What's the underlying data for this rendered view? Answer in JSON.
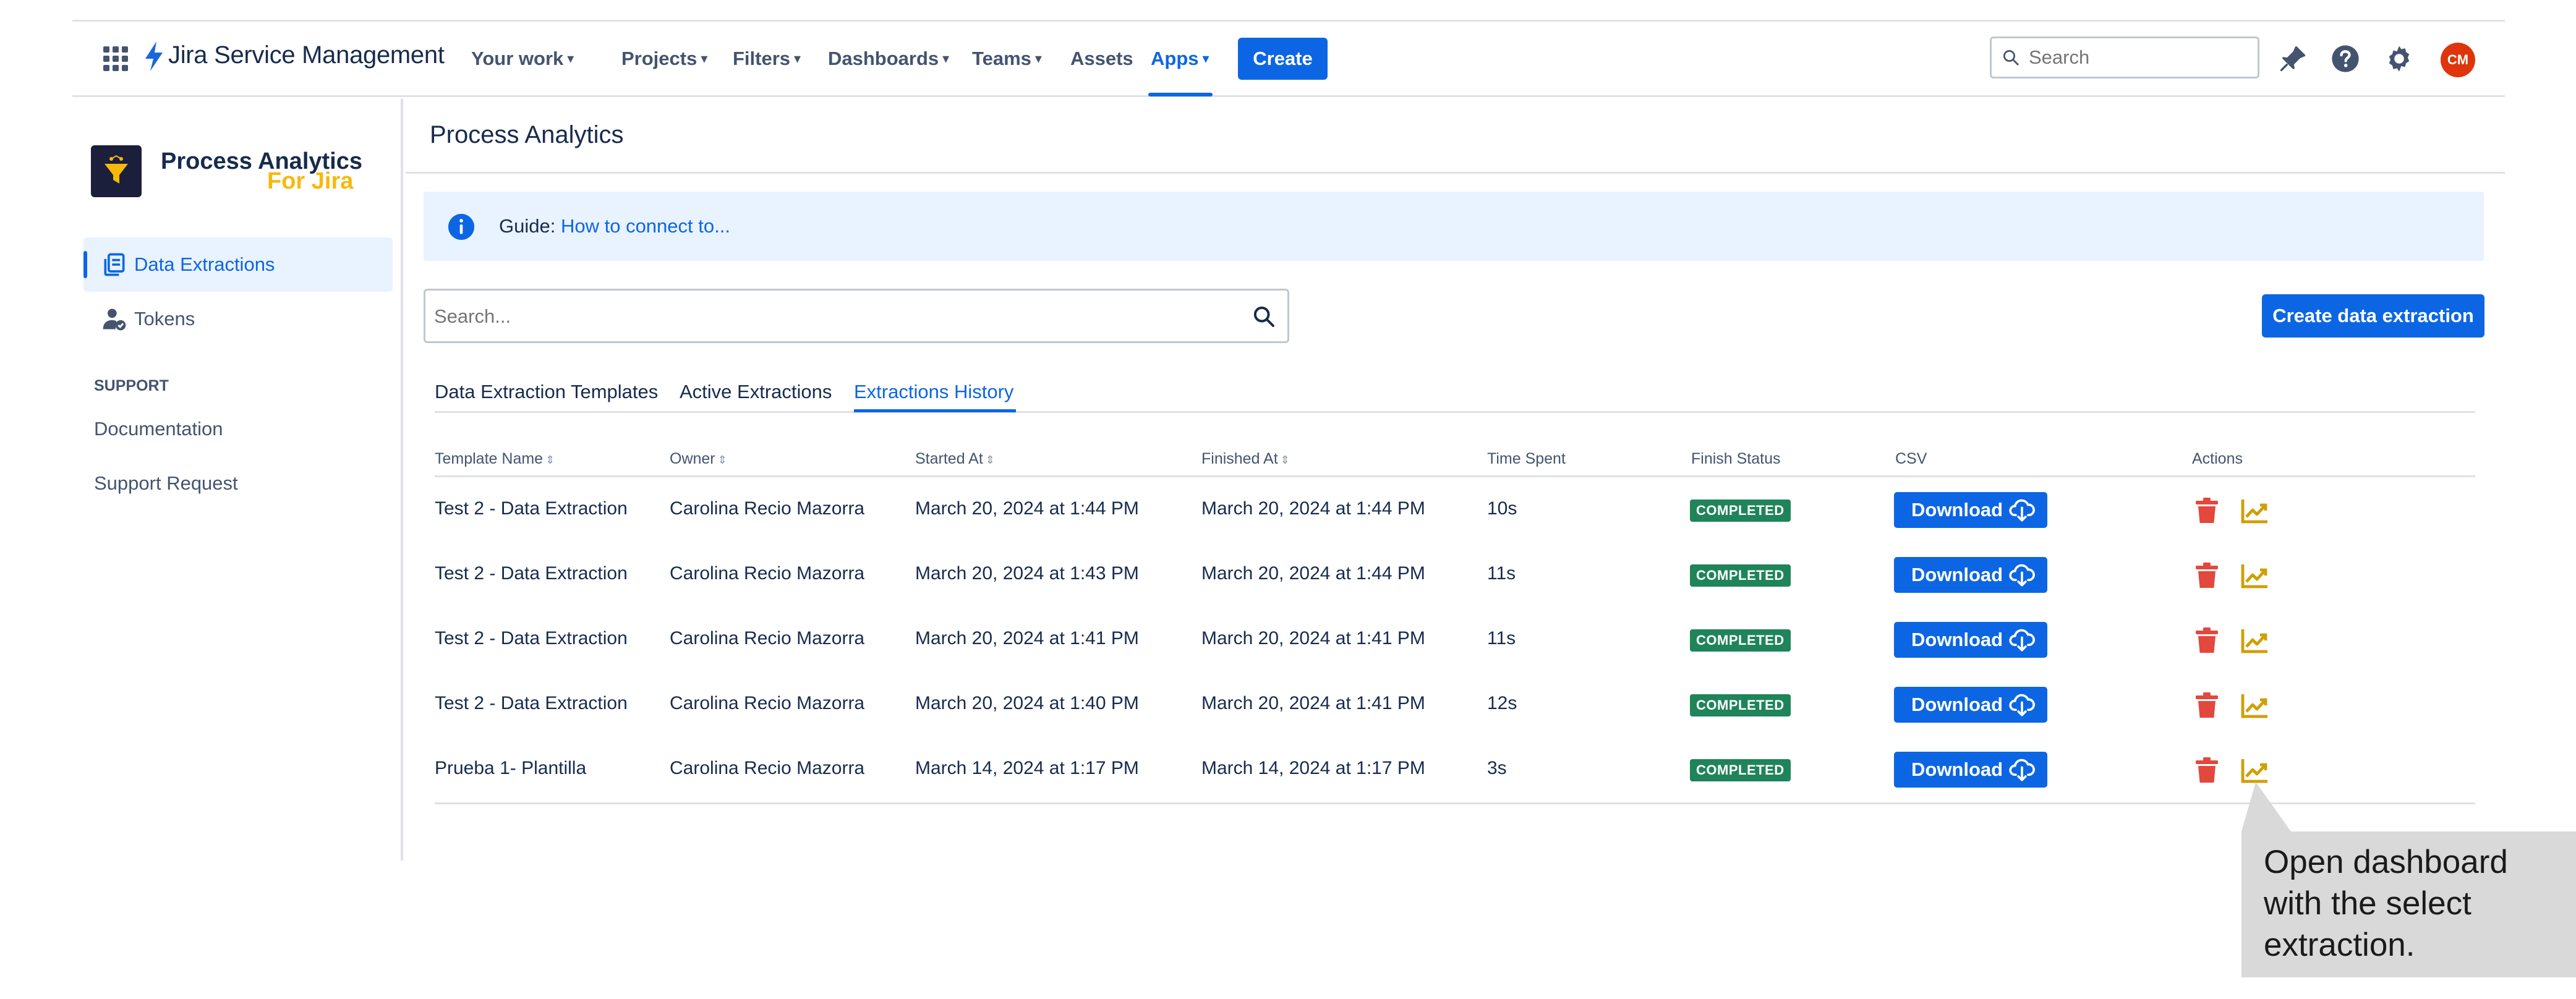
{
  "nav": {
    "product_name": "Jira Service Management",
    "items": [
      {
        "label": "Your work",
        "dropdown": true
      },
      {
        "label": "Projects",
        "dropdown": true
      },
      {
        "label": "Filters",
        "dropdown": true
      },
      {
        "label": "Dashboards",
        "dropdown": true
      },
      {
        "label": "Teams",
        "dropdown": true
      },
      {
        "label": "Assets",
        "dropdown": false
      },
      {
        "label": "Apps",
        "dropdown": true,
        "active": true
      }
    ],
    "create_label": "Create",
    "search_placeholder": "Search",
    "avatar_initials": "CM"
  },
  "sidebar": {
    "brand_title": "Process Analytics",
    "brand_subtitle": "For Jira",
    "items": [
      {
        "label": "Data Extractions",
        "active": true
      },
      {
        "label": "Tokens",
        "active": false
      }
    ],
    "support_heading": "SUPPORT",
    "support_links": [
      "Documentation",
      "Support Request"
    ]
  },
  "main": {
    "page_title": "Process Analytics",
    "guide_prefix": "Guide:",
    "guide_link": "How to connect to...",
    "search_placeholder": "Search...",
    "create_button": "Create data extraction",
    "tabs": [
      {
        "label": "Data Extraction Templates",
        "active": false
      },
      {
        "label": "Active Extractions",
        "active": false
      },
      {
        "label": "Extractions History",
        "active": true
      }
    ],
    "columns": [
      {
        "label": "Template Name",
        "sortable": true
      },
      {
        "label": "Owner",
        "sortable": true
      },
      {
        "label": "Started At",
        "sortable": true
      },
      {
        "label": "Finished At",
        "sortable": true
      },
      {
        "label": "Time Spent",
        "sortable": false
      },
      {
        "label": "Finish Status",
        "sortable": false
      },
      {
        "label": "CSV",
        "sortable": false
      },
      {
        "label": "Actions",
        "sortable": false
      }
    ],
    "download_label": "Download",
    "rows": [
      {
        "template": "Test 2 - Data Extraction",
        "owner": "Carolina Recio Mazorra",
        "started": "March 20, 2024 at 1:44 PM",
        "finished": "March 20, 2024 at 1:44 PM",
        "time": "10s",
        "status": "COMPLETED"
      },
      {
        "template": "Test 2 - Data Extraction",
        "owner": "Carolina Recio Mazorra",
        "started": "March 20, 2024 at 1:43 PM",
        "finished": "March 20, 2024 at 1:44 PM",
        "time": "11s",
        "status": "COMPLETED"
      },
      {
        "template": "Test 2 - Data Extraction",
        "owner": "Carolina Recio Mazorra",
        "started": "March 20, 2024 at 1:41 PM",
        "finished": "March 20, 2024 at 1:41 PM",
        "time": "11s",
        "status": "COMPLETED"
      },
      {
        "template": "Test 2 - Data Extraction",
        "owner": "Carolina Recio Mazorra",
        "started": "March 20, 2024 at 1:40 PM",
        "finished": "March 20, 2024 at 1:41 PM",
        "time": "12s",
        "status": "COMPLETED"
      },
      {
        "template": "Prueba 1- Plantilla",
        "owner": "Carolina Recio Mazorra",
        "started": "March 14, 2024 at 1:17 PM",
        "finished": "March 14, 2024 at 1:17 PM",
        "time": "3s",
        "status": "COMPLETED"
      }
    ]
  },
  "callout": {
    "text": "Open dashboard with the select extraction."
  },
  "colors": {
    "accent": "#0c66e4",
    "success": "#1f845a",
    "danger": "#e2483d",
    "chart_icon": "#cf9f02",
    "brand_yellow": "#f6b90b"
  },
  "icons": {
    "app_switcher": "grid-icon",
    "search": "search-icon",
    "notifications": "notification-icon",
    "help": "help-icon",
    "settings": "gear-icon",
    "info": "info-icon",
    "download": "cloud-download-icon",
    "delete": "trash-icon",
    "open_dashboard": "chart-line-icon"
  }
}
